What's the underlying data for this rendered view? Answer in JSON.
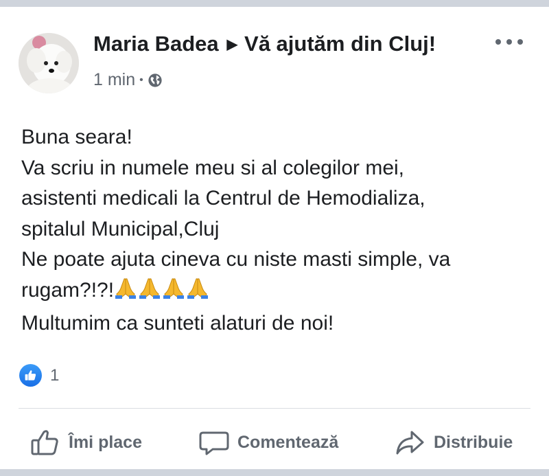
{
  "post": {
    "author": "Maria Badea",
    "group": "Vă ajutăm din Cluj!",
    "time": "1 min",
    "separator": "•",
    "privacy_icon": "globe-icon",
    "body_lines": [
      "Buna seara!",
      "Va scriu in numele meu si al  colegilor mei,",
      "asistenti medicali la Centrul de Hemodializa,",
      "spitalul Municipal,Cluj",
      "Ne poate ajuta cineva cu niste masti simple, va",
      "rugam?!?!",
      "Multumim ca sunteti alaturi de noi!"
    ],
    "emoji_count": 4,
    "reaction_count": "1"
  },
  "actions": {
    "like": "Îmi place",
    "comment": "Comentează",
    "share": "Distribuie"
  },
  "colors": {
    "text": "#1c1e21",
    "secondary": "#606770",
    "like_blue": "#1877f2",
    "background": "#cfd4dc"
  }
}
